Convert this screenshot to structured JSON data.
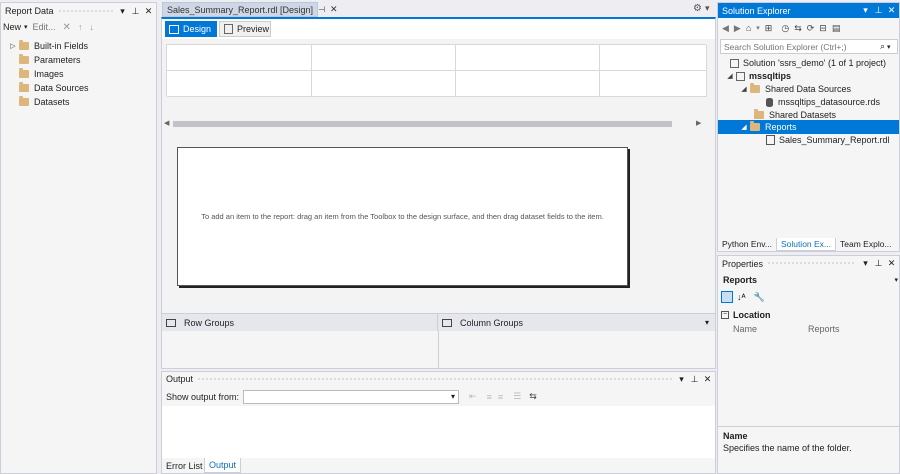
{
  "report_data": {
    "title": "Report Data",
    "toolbar": {
      "new_label": "New",
      "edit_label": "Edit..."
    },
    "items": [
      "Built-in Fields",
      "Parameters",
      "Images",
      "Data Sources",
      "Datasets"
    ]
  },
  "document_tab": {
    "title": "Sales_Summary_Report.rdl [Design]"
  },
  "designer": {
    "tabs": {
      "design": "Design",
      "preview": "Preview"
    },
    "placeholder": "To add an item to the report: drag an item from the Toolbox to the design surface, and then drag dataset fields to the item."
  },
  "grouping": {
    "row_groups": "Row Groups",
    "column_groups": "Column Groups"
  },
  "output": {
    "title": "Output",
    "show_from_label": "Show output from:",
    "tabs": {
      "error_list": "Error List",
      "output": "Output"
    }
  },
  "solution_explorer": {
    "title": "Solution Explorer",
    "search_placeholder": "Search Solution Explorer (Ctrl+;)",
    "tree": {
      "solution": "Solution 'ssrs_demo' (1 of 1 project)",
      "project": "mssqltips",
      "shared_data_sources": "Shared Data Sources",
      "datasource": "mssqltips_datasource.rds",
      "shared_datasets": "Shared Datasets",
      "reports": "Reports",
      "report_file": "Sales_Summary_Report.rdl"
    },
    "tabs": {
      "python": "Python Env...",
      "solution": "Solution Ex...",
      "team": "Team Explo..."
    }
  },
  "properties": {
    "title": "Properties",
    "object": "Reports",
    "category": "Location",
    "rows": [
      {
        "name": "Name",
        "value": "Reports"
      }
    ],
    "description_title": "Name",
    "description_text": "Specifies the name of the folder."
  },
  "colors": {
    "accent": "#0078d7",
    "folder": "#dcb67a",
    "selection": "#0078d7"
  }
}
